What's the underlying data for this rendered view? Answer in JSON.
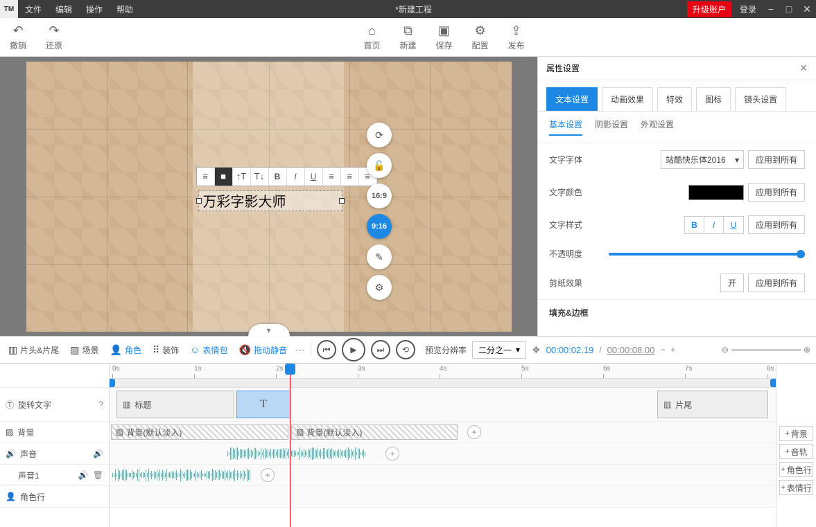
{
  "app": {
    "logo": "TM",
    "title": "*新建工程",
    "upgrade": "升级账户",
    "login": "登录"
  },
  "menu": [
    "文件",
    "编辑",
    "操作",
    "帮助"
  ],
  "toolbar": {
    "undo": "撤销",
    "redo": "还原",
    "home": "首页",
    "new": "新建",
    "save": "保存",
    "config": "配置",
    "publish": "发布"
  },
  "canvas": {
    "text": "万彩字影大师",
    "aspect": {
      "ratio1": "16:9",
      "ratio2": "9:16"
    }
  },
  "props": {
    "title": "属性设置",
    "tabs": [
      "文本设置",
      "动画效果",
      "特效",
      "图标",
      "镜头设置"
    ],
    "subtabs": [
      "基本设置",
      "阴影设置",
      "外观设置"
    ],
    "font_label": "文字字体",
    "font_value": "站酷快乐体2016",
    "color_label": "文字颜色",
    "style_label": "文字样式",
    "opacity_label": "不透明度",
    "papercut_label": "剪纸效果",
    "papercut_toggle": "开",
    "apply_all": "应用到所有",
    "section2": "填充&边框"
  },
  "timeline_bar": {
    "head_tail": "片头&片尾",
    "scene": "场景",
    "role": "角色",
    "deco": "装饰",
    "emoji": "表情包",
    "drag_mute": "拖动静音",
    "preview_label": "预览分辨率",
    "preview_value": "二分之一",
    "time_current": "00:00:02.19",
    "time_sep": " / ",
    "time_duration": "00:00:08.00"
  },
  "ruler": [
    "0s",
    "1s",
    "2s",
    "3s",
    "4s",
    "5s",
    "6s",
    "7s",
    "8s"
  ],
  "tracks": {
    "text": "旋转文字",
    "bg": "背景",
    "sound": "声音",
    "sound1": "声音1",
    "role_row": "角色行",
    "clip_title": "标题",
    "clip_t": "T",
    "clip_tail": "片尾",
    "bg_clip": "背景(默认淡入)"
  },
  "side": {
    "bg": "背景",
    "track": "音轨",
    "role": "角色行",
    "emoji": "表情行"
  }
}
